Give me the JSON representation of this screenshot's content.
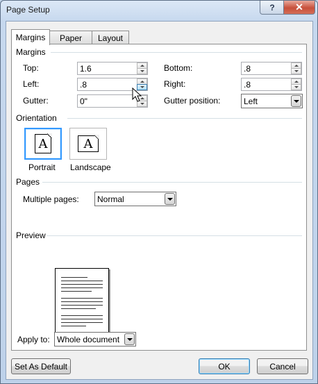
{
  "window": {
    "title": "Page Setup",
    "help_glyph": "?",
    "close_glyph": "✕"
  },
  "tabs": [
    "Margins",
    "Paper",
    "Layout"
  ],
  "margins": {
    "section_title": "Margins",
    "top": {
      "label": "Top:",
      "value": "1.6"
    },
    "bottom": {
      "label": "Bottom:",
      "value": ".8"
    },
    "left": {
      "label": "Left:",
      "value": ".8"
    },
    "right": {
      "label": "Right:",
      "value": ".8"
    },
    "gutter": {
      "label": "Gutter:",
      "value": "0\""
    },
    "gutter_position": {
      "label": "Gutter position:",
      "value": "Left"
    }
  },
  "orientation": {
    "section_title": "Orientation",
    "portrait": {
      "label": "Portrait",
      "glyph": "A",
      "selected": true
    },
    "landscape": {
      "label": "Landscape",
      "glyph": "A"
    }
  },
  "pages": {
    "section_title": "Pages",
    "multiple_pages": {
      "label": "Multiple pages:",
      "value": "Normal"
    }
  },
  "preview": {
    "section_title": "Preview"
  },
  "apply_to": {
    "label": "Apply to:",
    "value": "Whole document"
  },
  "buttons": {
    "set_default": "Set As Default",
    "ok": "OK",
    "cancel": "Cancel"
  },
  "colors": {
    "selection": "#3399ff",
    "close": "#c7503b"
  }
}
